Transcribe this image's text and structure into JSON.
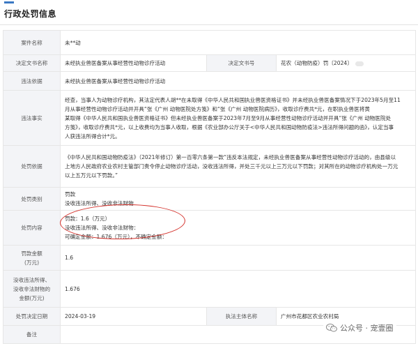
{
  "page": {
    "title": "行政处罚信息"
  },
  "rows": {
    "case_name": {
      "label": "案件名称",
      "value": "未**动"
    },
    "decision_name": {
      "label": "决定文书名称",
      "value": "未经执业兽医备案从事经营性动物诊疗活动"
    },
    "decision_no": {
      "label": "决定文书号",
      "value": "花农（动物防疫）罚〔2024〕"
    },
    "basis_violation": {
      "label": "违法依据",
      "value": "未经执业兽医备案从事经营性动物诊疗活动"
    },
    "facts": {
      "label": "违法事实",
      "lines": [
        "经查，当事人为动物诊疗机构，其法定代表人胡**在未取得《中华人民共和国执业兽医资格证书》并未经执业兽医备案情况下于2023年5月至11",
        "月从事经营性动物诊疗活动并开具“张《广州      动物医院处方笺》和“张《广州      动物医院病历》，收取诊疗费共*元，在职执业兽医将黄",
        "某取得《中华人民共和国执业兽医资格证书》但未经执业兽医备案于2023年7月至9月从事经营性动物诊疗活动并开具“张《广州      动物医院处",
        "方笺》，收取诊疗费共*元，以上收费均为当事人收取，根据《农业部办公厅关于<中华人民共和国动物防疫法>违法所得问题的函》，认定当事",
        "人获违法所得合计*元。"
      ]
    },
    "penalty_basis": {
      "label": "处罚依据",
      "lines": [
        "《中华人民共和国动物防疫法》（2021年修订）第一百零六条第一款“违反本法规定，未经执业兽医备案从事经营性动物诊疗活动的，由县级以",
        "上地方人民政府农业农村主管部门责令停止动物诊疗活动，没收违法所得，并处三千元以上三万元以下罚款；对其所在的动物诊疗机构处一万元",
        "以上五万元以下罚款。”"
      ]
    },
    "penalty_type": {
      "label": "处罚类别",
      "lines": [
        "罚款",
        "没收违法所得、没收非法财物"
      ]
    },
    "penalty_content": {
      "label": "处罚内容",
      "lines": [
        "罚款：1.6（万元）",
        "没收违法所得、没收非法财物：",
        "可确定金额：1.676（万元），不确定金额："
      ]
    },
    "fine_amount": {
      "label_lines": [
        "罚款金额",
        "(万元)"
      ],
      "value": "1.6"
    },
    "confiscation_amount": {
      "label_lines": [
        "没收违法所得、",
        "没收非法财物的",
        "金额(万元)"
      ],
      "value": "1.676"
    },
    "decision_date": {
      "label": "处罚决定日期",
      "value": "2024-03-19"
    },
    "enforcer": {
      "label": "执法主体名称",
      "value": "广州市花都区农业农村局"
    },
    "remarks": {
      "label": "备注",
      "value": ""
    }
  },
  "watermark": {
    "text": "公众号 · 宠壹圈",
    "icon": "wechat-icon"
  },
  "colors": {
    "accent": "#3a78c3",
    "annotation": "#d4312b",
    "label_bg": "#f3f4f7"
  }
}
